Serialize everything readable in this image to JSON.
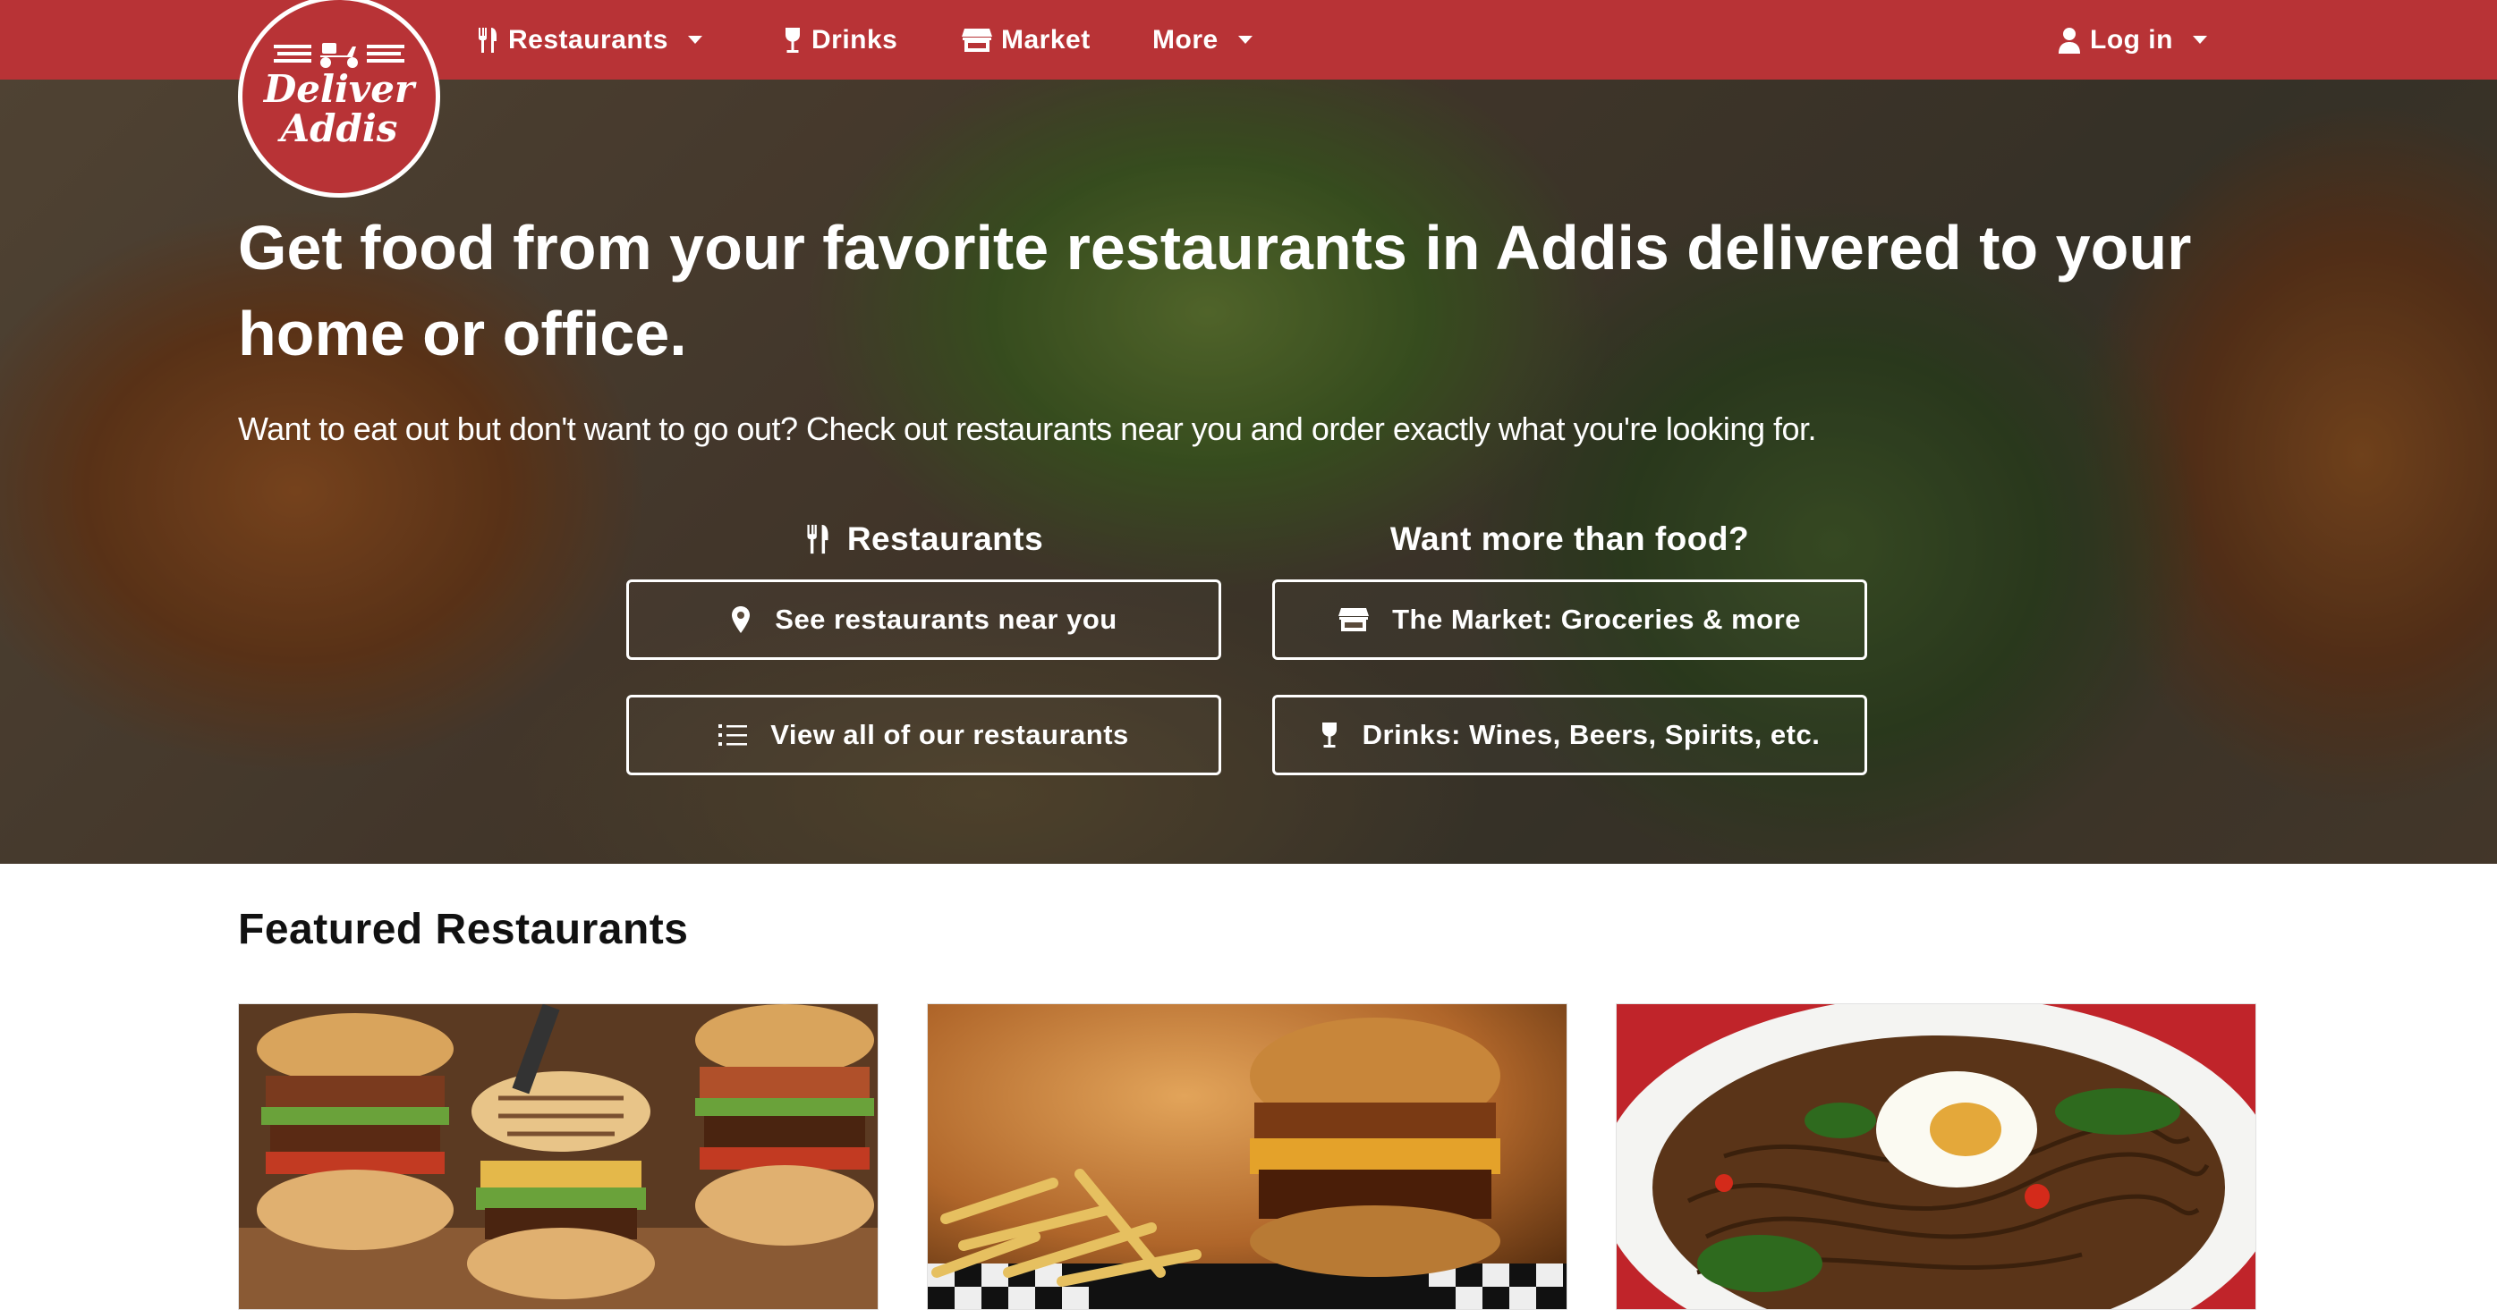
{
  "nav": {
    "logo_line1": "Deliver",
    "logo_line2": "Addis",
    "restaurants": "Restaurants",
    "drinks": "Drinks",
    "market": "Market",
    "more": "More",
    "login": "Log in"
  },
  "hero": {
    "headline": "Get food from your favorite restaurants in Addis delivered to your home or office.",
    "subline": "Want to eat out but don't want to go out? Check out restaurants near you and order exactly what you're looking for.",
    "col_restaurants": "Restaurants",
    "col_more": "Want more than food?",
    "btn_near": "See restaurants near you",
    "btn_all": "View all of our restaurants",
    "btn_market": "The Market: Groceries & more",
    "btn_drinks": "Drinks: Wines, Beers, Spirits, etc."
  },
  "featured": {
    "title": "Featured Restaurants"
  },
  "colors": {
    "brand_red": "#b83336",
    "white": "#ffffff"
  },
  "icons": [
    "logo-scooter-icon",
    "utensils-icon",
    "wine-glass-icon",
    "store-icon",
    "user-icon",
    "map-pin-icon",
    "list-icon"
  ]
}
